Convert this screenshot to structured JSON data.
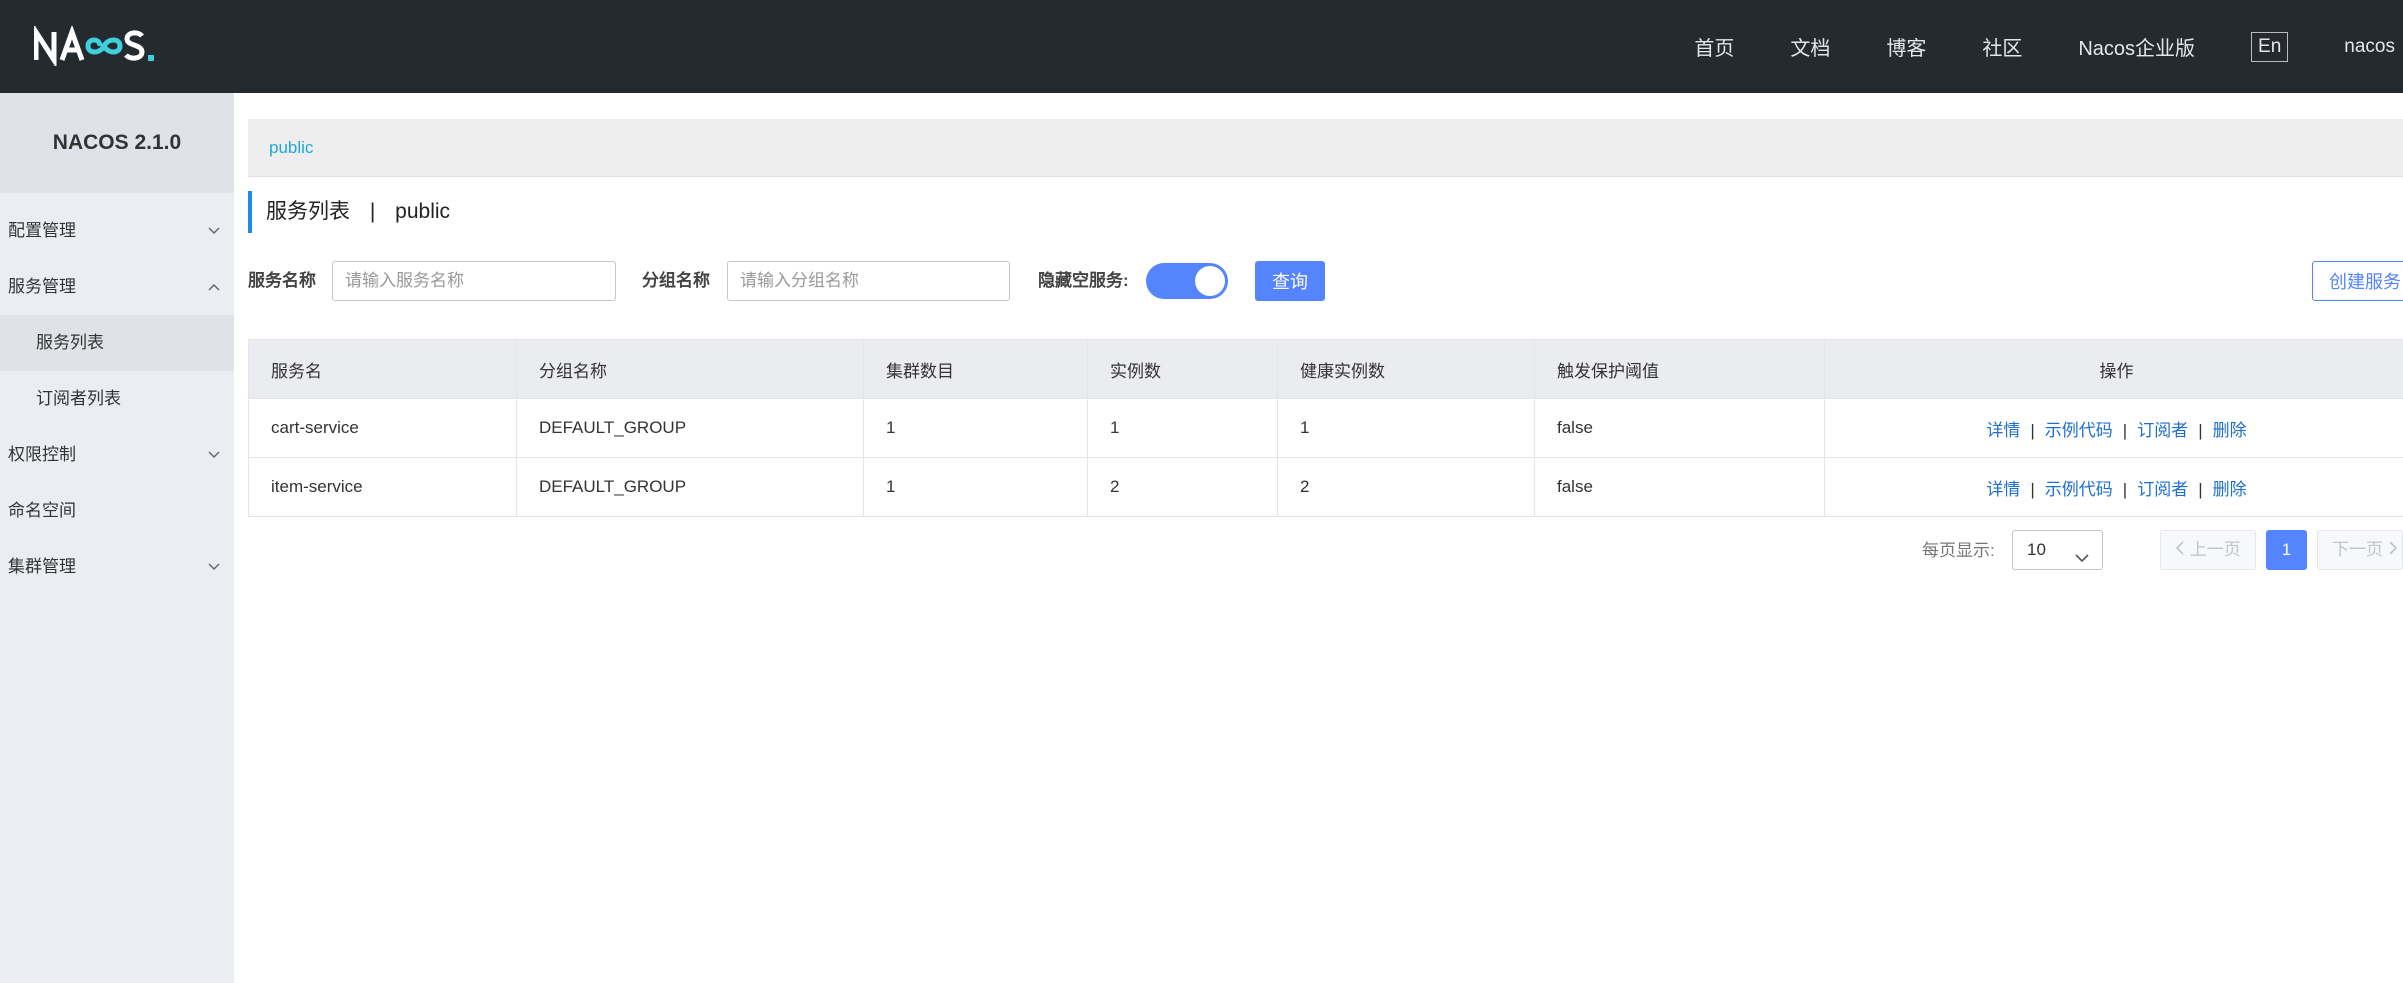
{
  "header": {
    "logo_text": "NACOS.",
    "nav": [
      "首页",
      "文档",
      "博客",
      "社区",
      "Nacos企业版"
    ],
    "lang": "En",
    "user": "nacos"
  },
  "sidebar": {
    "version": "NACOS 2.1.0",
    "items": {
      "config": "配置管理",
      "service": "服务管理",
      "service_list": "服务列表",
      "subscriber_list": "订阅者列表",
      "auth": "权限控制",
      "namespace": "命名空间",
      "cluster": "集群管理"
    }
  },
  "main": {
    "namespace": "public",
    "title": "服务列表",
    "title_sep": "|",
    "title_ns": "public",
    "filters": {
      "service_name_label": "服务名称",
      "service_name_placeholder": "请输入服务名称",
      "group_name_label": "分组名称",
      "group_name_placeholder": "请输入分组名称",
      "hide_empty_label": "隐藏空服务:",
      "hide_empty_on": true,
      "query_button": "查询",
      "create_button": "创建服务"
    },
    "table": {
      "columns": [
        "服务名",
        "分组名称",
        "集群数目",
        "实例数",
        "健康实例数",
        "触发保护阈值",
        "操作"
      ],
      "rows": [
        [
          "cart-service",
          "DEFAULT_GROUP",
          "1",
          "1",
          "1",
          "false"
        ],
        [
          "item-service",
          "DEFAULT_GROUP",
          "1",
          "2",
          "2",
          "false"
        ]
      ],
      "actions": [
        "详情",
        "示例代码",
        "订阅者",
        "删除"
      ],
      "action_sep": "|"
    },
    "pagination": {
      "page_size_label": "每页显示:",
      "page_size": "10",
      "prev": "上一页",
      "current": "1",
      "next": "下一页"
    }
  },
  "colors": {
    "header_bg": "#252a2f",
    "sidebar_bg": "#eaedf1",
    "primary": "#5584ff",
    "link": "#1f6fd1",
    "namespace_link": "#20a8d8"
  }
}
